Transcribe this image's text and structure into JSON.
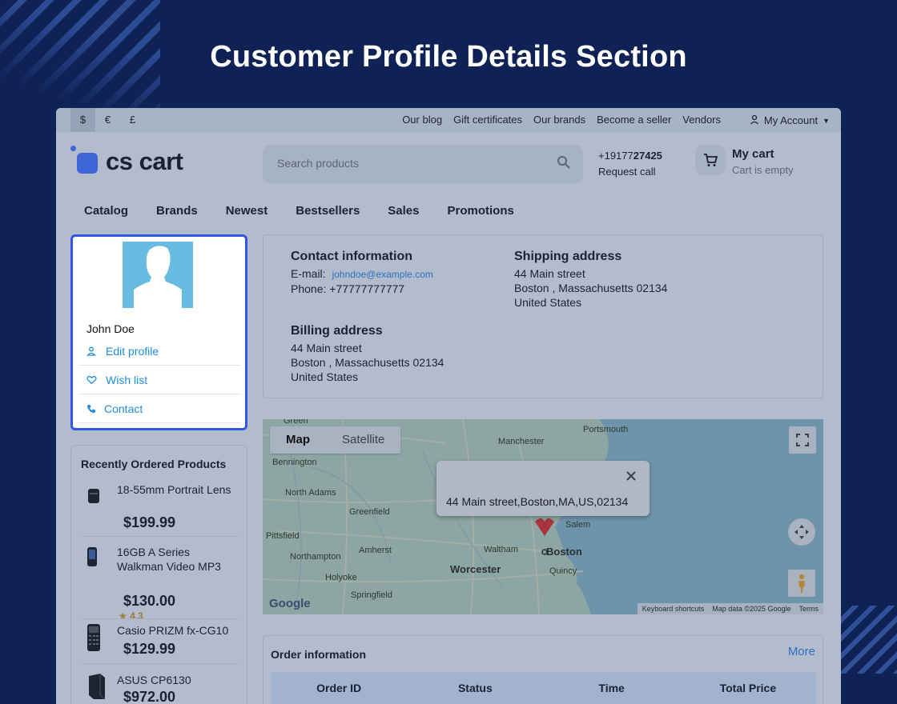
{
  "heading": "Customer Profile Details Section",
  "topbar": {
    "currencies": [
      "$",
      "€",
      "£"
    ],
    "links": [
      "Our blog",
      "Gift certificates",
      "Our brands",
      "Become a seller",
      "Vendors"
    ],
    "account": "My Account"
  },
  "header": {
    "logo": "cs cart",
    "search_placeholder": "Search products",
    "phone_prefix": "+19177",
    "phone_bold": "27425",
    "request_call": "Request call",
    "cart_title": "My cart",
    "cart_status": "Cart is empty"
  },
  "nav": [
    "Catalog",
    "Brands",
    "Newest",
    "Bestsellers",
    "Sales",
    "Promotions"
  ],
  "profile": {
    "name": "John Doe",
    "menu": [
      "Edit profile",
      "Wish list",
      "Contact"
    ]
  },
  "recent": {
    "title": "Recently Ordered Products",
    "items": [
      {
        "name": "18-55mm Portrait Lens",
        "price": "$199.99"
      },
      {
        "name": "16GB A Series Walkman Video MP3",
        "price": "$130.00",
        "rating": "4.3"
      },
      {
        "name": "Casio PRIZM fx-CG10",
        "price": "$129.99"
      },
      {
        "name": "ASUS CP6130",
        "price": "$972.00"
      }
    ]
  },
  "info": {
    "contact_title": "Contact information",
    "email_label": "E-mail:",
    "email": "johndoe@example.com",
    "phone": "Phone: +77777777777",
    "shipping_title": "Shipping address",
    "shipping_lines": [
      "44 Main street",
      "Boston , Massachusetts 02134",
      "United States"
    ],
    "billing_title": "Billing address",
    "billing_lines": [
      "44 Main street",
      "Boston , Massachusetts 02134",
      "United States"
    ]
  },
  "map": {
    "tabs": [
      "Map",
      "Satellite"
    ],
    "popup": "44 Main street,Boston,MA,US,02134",
    "google": "Google",
    "attribution": [
      "Keyboard shortcuts",
      "Map data ©2025 Google",
      "Terms"
    ],
    "labels": [
      "Green",
      "Manchester",
      "Portsmouth",
      "Bennington",
      "North Adams",
      "Greenfield",
      "Pittsfield",
      "Amherst",
      "Northampton",
      "Waltham",
      "Salem",
      "Holyoke",
      "Springfield",
      "Quincy"
    ],
    "cities": [
      "Boston",
      "Worcester"
    ]
  },
  "orders": {
    "title": "Order information",
    "more": "More",
    "columns": [
      "Order ID",
      "Status",
      "Time",
      "Total Price"
    ]
  }
}
